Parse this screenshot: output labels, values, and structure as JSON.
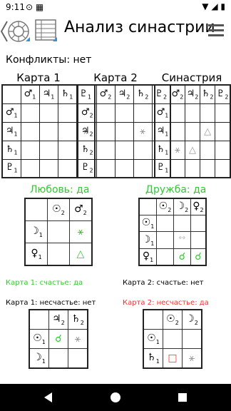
{
  "status": {
    "time": "9:11"
  },
  "app": {
    "title": "Анализ синастрии"
  },
  "conflicts": "Конфликты: нет",
  "charts": {
    "chart1_title": "Карта 1",
    "chart2_title": "Карта 2",
    "syn_title": "Синастрия"
  },
  "love": {
    "label": "Любовь: да"
  },
  "friendship": {
    "label": "Дружба: да"
  },
  "happiness": {
    "c1_happy": "Карта 1: счастье: да",
    "c2_happy": "Карта 2: счастье: нет",
    "c1_unhappy": "Карта 1: несчастье: нет",
    "c2_unhappy": "Карта 2: несчастье: да"
  },
  "colors": {
    "green": "#2ecc2e",
    "red": "#ff2e2e",
    "grey": "#9a9a9a"
  }
}
